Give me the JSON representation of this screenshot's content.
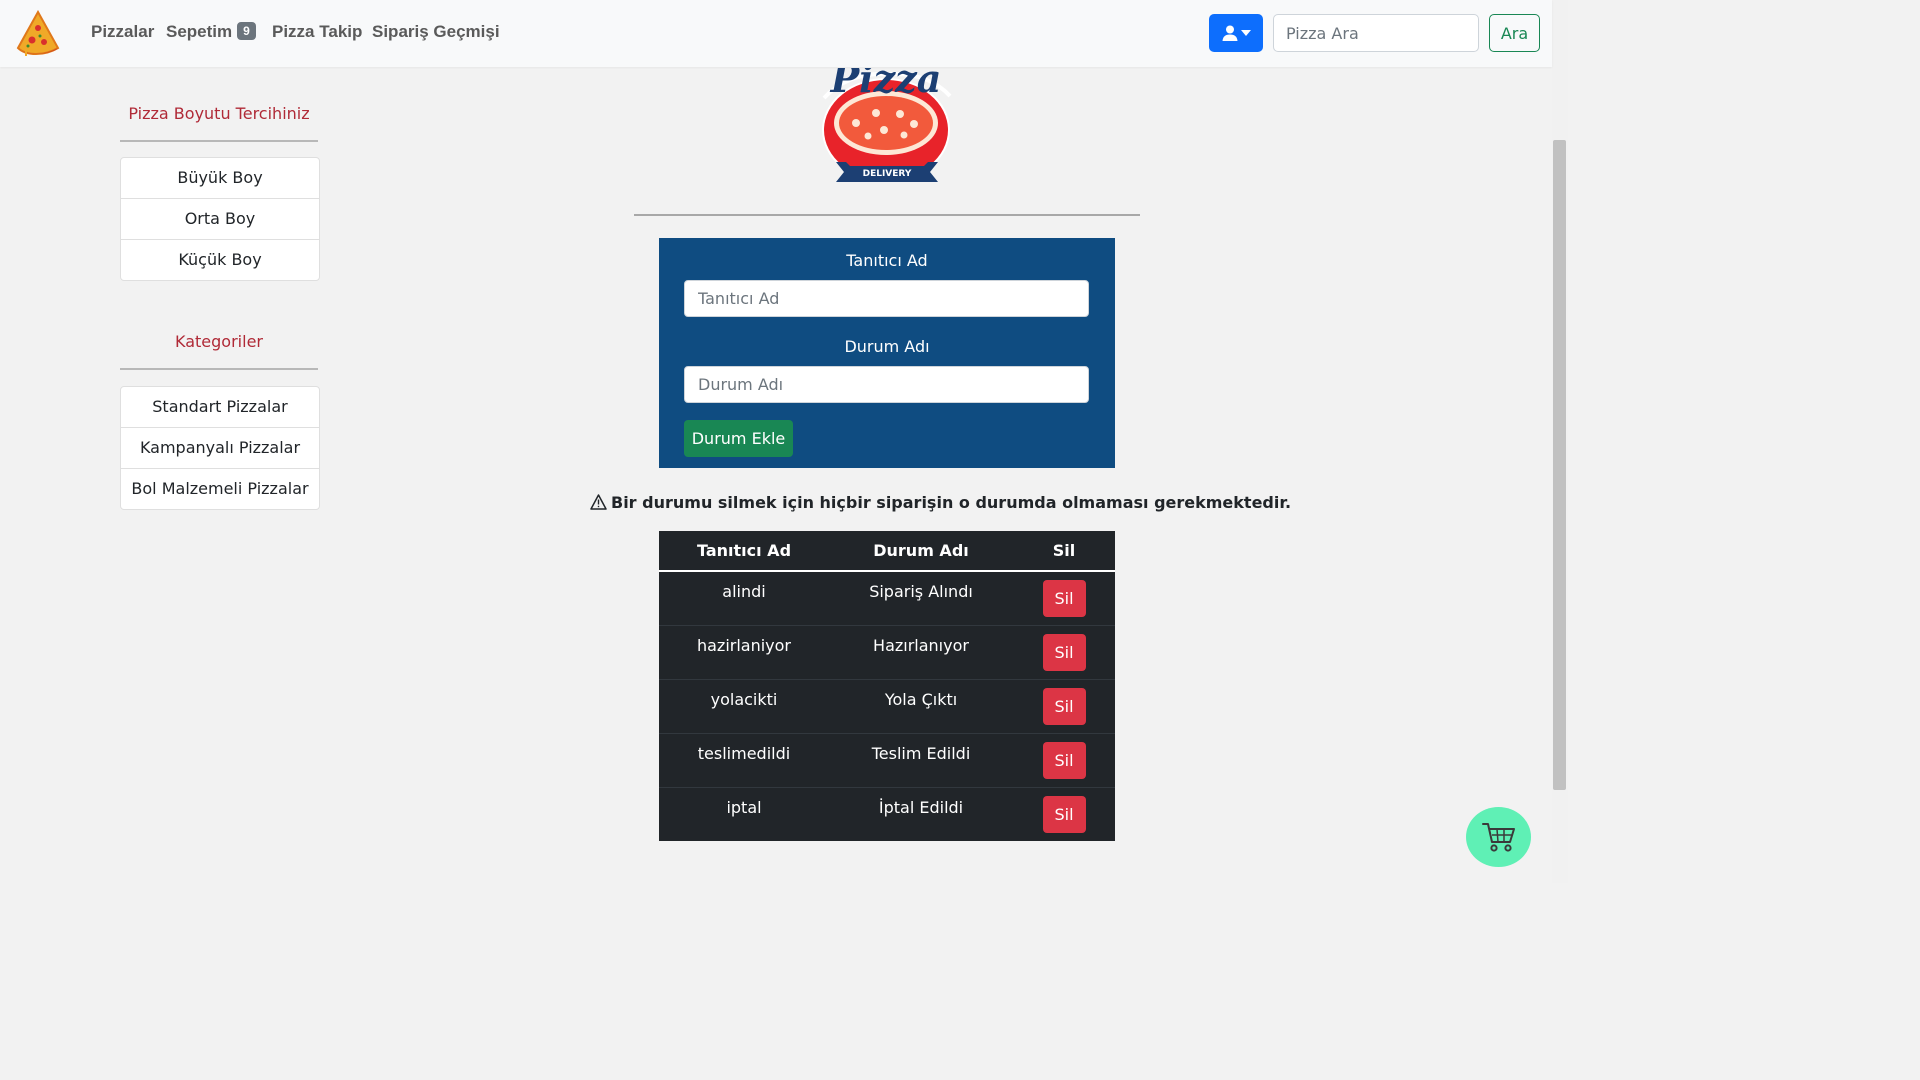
{
  "navbar": {
    "links": [
      "Pizzalar",
      "Sepetim",
      "Pizza Takip",
      "Sipariş Geçmişi"
    ],
    "cart_count": "9",
    "search_placeholder": "Pizza Ara",
    "search_button": "Ara"
  },
  "sidebar": {
    "size_title": "Pizza Boyutu Tercihiniz",
    "sizes": [
      "Büyük Boy",
      "Orta Boy",
      "Küçük Boy"
    ],
    "category_title": "Kategoriler",
    "categories": [
      "Standart Pizzalar",
      "Kampanyalı Pizzalar",
      "Bol Malzemeli Pizzalar"
    ]
  },
  "logo": {
    "word": "Pizza",
    "tag": "DELIVERY"
  },
  "form": {
    "id_label": "Tanıtıcı Ad",
    "id_placeholder": "Tanıtıcı Ad",
    "name_label": "Durum Adı",
    "name_placeholder": "Durum Adı",
    "submit_label": "Durum Ekle"
  },
  "warning_text": "Bir durumu silmek için hiçbir siparişin o durumda olmaması gerekmektedir.",
  "table": {
    "headers": [
      "Tanıtıcı Ad",
      "Durum Adı",
      "Sil"
    ],
    "rows": [
      {
        "id": "alindi",
        "name": "Sipariş Alındı",
        "action": "Sil"
      },
      {
        "id": "hazirlaniyor",
        "name": "Hazırlanıyor",
        "action": "Sil"
      },
      {
        "id": "yolacikti",
        "name": "Yola Çıktı",
        "action": "Sil"
      },
      {
        "id": "teslimedildi",
        "name": "Teslim Edildi",
        "action": "Sil"
      },
      {
        "id": "iptal",
        "name": "İptal Edildi",
        "action": "Sil"
      }
    ]
  },
  "colors": {
    "primary": "#0d6efd",
    "success": "#198754",
    "danger": "#dc3545",
    "form_bg": "#0f4c81",
    "table_bg": "#212529",
    "cart_fab": "#5ff0b5"
  },
  "icons": [
    "pizza-slice-icon",
    "user-icon",
    "caret-down-icon",
    "warning-icon",
    "shopping-cart-icon"
  ]
}
